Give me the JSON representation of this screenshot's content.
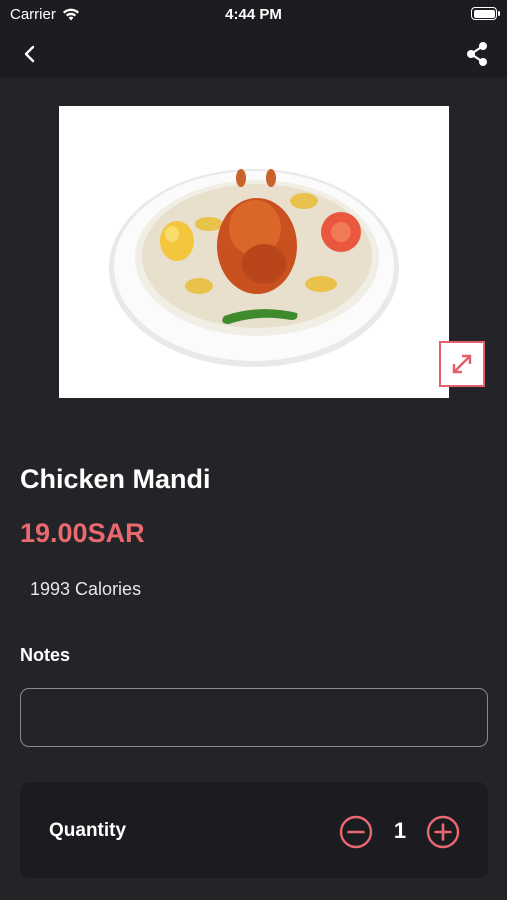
{
  "status_bar": {
    "carrier": "Carrier",
    "time": "4:44 PM"
  },
  "nav": {
    "back_icon": "chevron-left-icon",
    "share_icon": "share-icon"
  },
  "product": {
    "image_alt": "Chicken Mandi",
    "name": "Chicken Mandi",
    "price": "19.00SAR",
    "calories": "1993 Calories"
  },
  "notes": {
    "label": "Notes",
    "value": "",
    "placeholder": ""
  },
  "quantity": {
    "label": "Quantity",
    "value": "1"
  },
  "colors": {
    "accent": "#e8696f",
    "background": "#232427",
    "card": "#1b1c1f"
  }
}
